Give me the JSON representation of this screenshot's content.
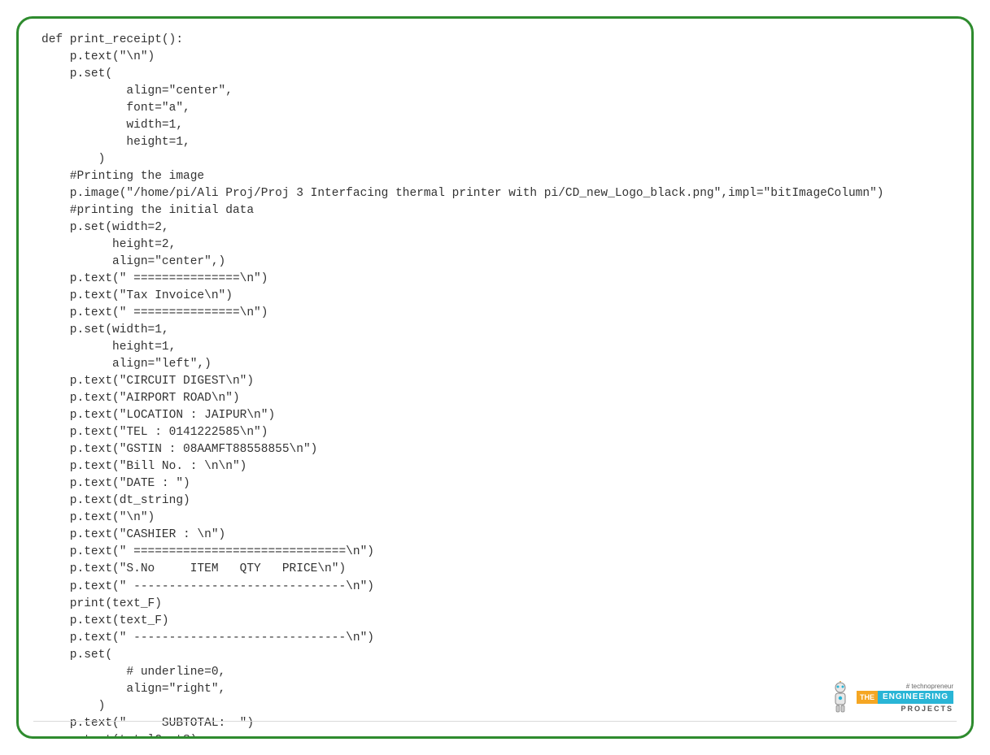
{
  "code": "def print_receipt():\n    p.text(\"\\n\")\n    p.set(\n            align=\"center\",\n            font=\"a\",\n            width=1,\n            height=1,\n        )\n    #Printing the image\n    p.image(\"/home/pi/Ali Proj/Proj 3 Interfacing thermal printer with pi/CD_new_Logo_black.png\",impl=\"bitImageColumn\")\n    #printing the initial data\n    p.set(width=2,\n          height=2,\n          align=\"center\",)\n    p.text(\" ===============\\n\")\n    p.text(\"Tax Invoice\\n\")\n    p.text(\" ===============\\n\")\n    p.set(width=1,\n          height=1,\n          align=\"left\",)\n    p.text(\"CIRCUIT DIGEST\\n\")\n    p.text(\"AIRPORT ROAD\\n\")\n    p.text(\"LOCATION : JAIPUR\\n\")\n    p.text(\"TEL : 0141222585\\n\")\n    p.text(\"GSTIN : 08AAMFT88558855\\n\")\n    p.text(\"Bill No. : \\n\\n\")\n    p.text(\"DATE : \")\n    p.text(dt_string)\n    p.text(\"\\n\")\n    p.text(\"CASHIER : \\n\")\n    p.text(\" ==============================\\n\")\n    p.text(\"S.No     ITEM   QTY   PRICE\\n\")\n    p.text(\" ------------------------------\\n\")\n    print(text_F)\n    p.text(text_F)\n    p.text(\" ------------------------------\\n\")\n    p.set(\n            # underline=0,\n            align=\"right\",\n        )\n    p.text(\"     SUBTOTAL:  \")\n    p.text(totalCostS)",
  "watermark": {
    "hashtag": "# technopreneur",
    "the": "THE",
    "engineering": "ENGINEERING",
    "projects": "PROJECTS"
  }
}
